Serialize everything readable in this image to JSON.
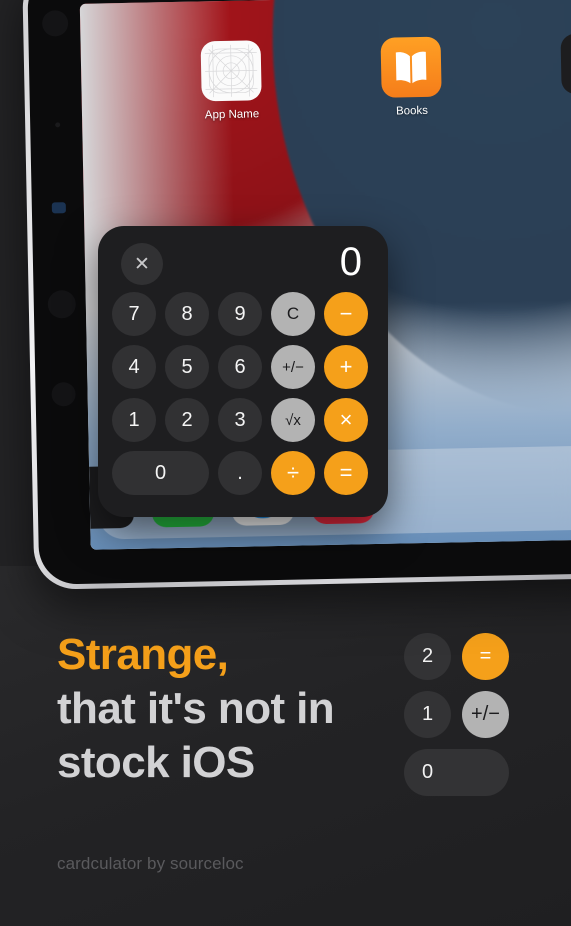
{
  "promo": {
    "headline_accent": "Strange,",
    "headline_line2": "that it's not in",
    "headline_line3": "stock iOS",
    "footer_note": "cardculator by sourceloc",
    "accent_color": "#f5a01a",
    "background_color": "#232325"
  },
  "mini_keypad": {
    "rows": [
      {
        "digit": "2",
        "op": "=",
        "op_style": "orange"
      },
      {
        "digit": "1",
        "op": "+/−",
        "op_style": "grey"
      }
    ],
    "zero_key": "0"
  },
  "home_screen": {
    "apps": [
      {
        "label": "App Name",
        "icon": "app-template-grid-icon"
      },
      {
        "label": "Books",
        "icon": "books-icon"
      },
      {
        "label": "",
        "icon": "apple-icon"
      }
    ],
    "dock": [
      {
        "name": "dock-icon-partial",
        "icon": "dark-app-icon"
      },
      {
        "name": "dock-icon-messages",
        "icon": "messages-icon"
      },
      {
        "name": "dock-icon-safari",
        "icon": "safari-icon"
      },
      {
        "name": "dock-icon-music",
        "icon": "music-icon"
      }
    ]
  },
  "calculator": {
    "display_value": "0",
    "close_label": "✕",
    "rows": [
      [
        {
          "label": "7",
          "style": "digit"
        },
        {
          "label": "8",
          "style": "digit"
        },
        {
          "label": "9",
          "style": "digit"
        },
        {
          "label": "C",
          "style": "grey"
        },
        {
          "label": "−",
          "style": "orange"
        }
      ],
      [
        {
          "label": "4",
          "style": "digit"
        },
        {
          "label": "5",
          "style": "digit"
        },
        {
          "label": "6",
          "style": "digit"
        },
        {
          "label": "+/−",
          "style": "grey"
        },
        {
          "label": "+",
          "style": "orange"
        }
      ],
      [
        {
          "label": "1",
          "style": "digit"
        },
        {
          "label": "2",
          "style": "digit"
        },
        {
          "label": "3",
          "style": "digit"
        },
        {
          "label": "√x",
          "style": "grey"
        },
        {
          "label": "×",
          "style": "orange"
        }
      ],
      [
        {
          "label": "0",
          "style": "wide"
        },
        {
          "label": ".",
          "style": "digit"
        },
        {
          "label": "÷",
          "style": "orange"
        },
        {
          "label": "=",
          "style": "orange"
        }
      ]
    ]
  }
}
